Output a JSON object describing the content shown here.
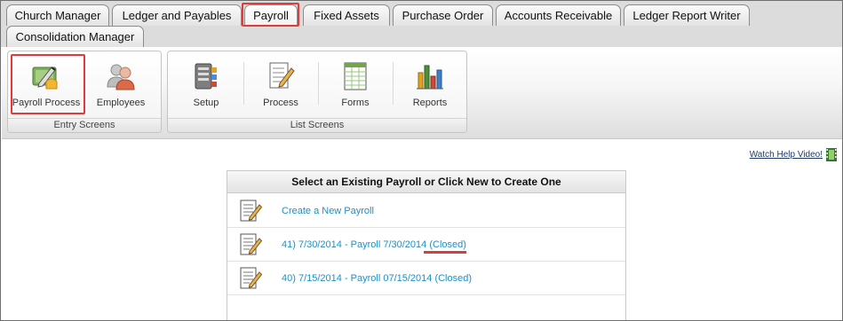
{
  "tabs": {
    "row1": [
      "Church Manager",
      "Ledger and Payables",
      "Payroll",
      "Fixed Assets",
      "Purchase Order",
      "Accounts Receivable",
      "Ledger Report Writer"
    ],
    "row2": [
      "Consolidation Manager"
    ],
    "active": "Payroll"
  },
  "ribbon": {
    "entry_group_label": "Entry Screens",
    "list_group_label": "List Screens",
    "buttons": {
      "payroll_process": "Payroll Process",
      "employees": "Employees",
      "setup": "Setup",
      "process": "Process",
      "forms": "Forms",
      "reports": "Reports"
    }
  },
  "help": {
    "label": "Watch Help Video!",
    "icon": "film-icon"
  },
  "panel": {
    "title": "Select an Existing Payroll or Click New to Create One",
    "rows": [
      {
        "label": "Create a New Payroll",
        "icon": "document-pencil-icon"
      },
      {
        "label": "41) 7/30/2014 - Payroll 7/30/2014 (Closed)",
        "icon": "document-pencil-icon"
      },
      {
        "label": "40) 7/15/2014 - Payroll 07/15/2014 (Closed)",
        "icon": "document-pencil-icon"
      }
    ]
  },
  "colors": {
    "link": "#1f8fc7",
    "highlight": "#e03a3a",
    "tab_bar": "#dcdcdc"
  }
}
